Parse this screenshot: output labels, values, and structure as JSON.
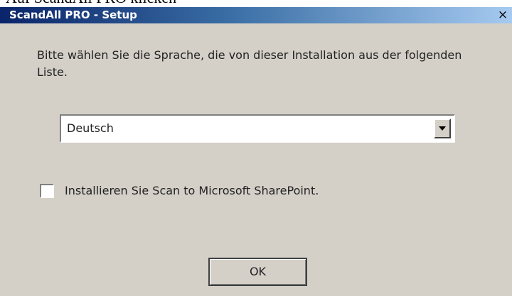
{
  "document": {
    "heading_fragment": "Auf ScandAll PRO klicken"
  },
  "window": {
    "title": "ScandAll PRO - Setup",
    "close_glyph": "×"
  },
  "dialog": {
    "instruction": "Bitte wählen Sie die Sprache, die von dieser Installation aus der folgenden Liste.",
    "language_select": {
      "selected": "Deutsch"
    },
    "sharepoint_option": {
      "label": "Installieren Sie Scan to Microsoft SharePoint.",
      "checked": false
    },
    "ok_label": "OK"
  },
  "icons": {
    "close": "close-icon",
    "dropdown": "chevron-down-icon"
  },
  "colors": {
    "titlebar_start": "#0a246a",
    "titlebar_end": "#a6caf0",
    "dialog_face": "#d4d0c8"
  }
}
